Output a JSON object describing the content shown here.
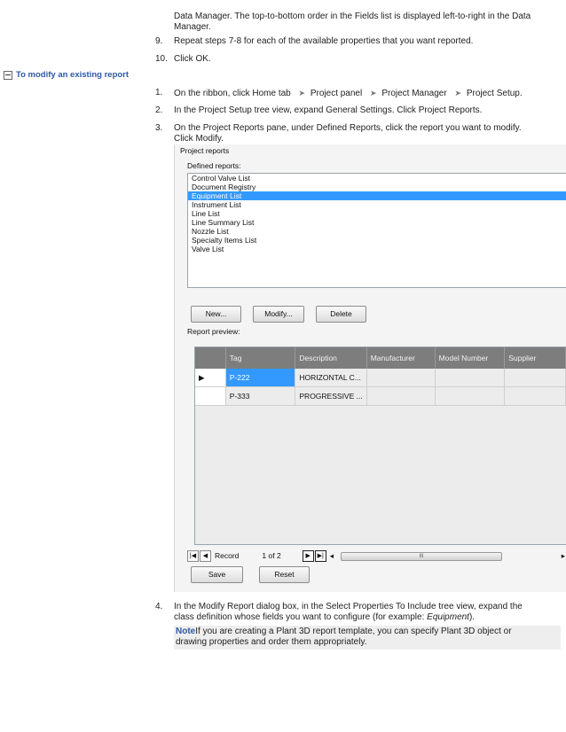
{
  "top_text_lines": [
    "Data Manager.  The top-to-bottom order in the Fields list is displayed left-to-right in the Data",
    "Manager."
  ],
  "steps_before": [
    {
      "num": "9.",
      "text": "Repeat steps 7-8 for each of the available properties that you want reported."
    },
    {
      "num": "10.",
      "text": "Click OK."
    }
  ],
  "section": {
    "label": "To modify an existing report",
    "icon": "collapse-minus-icon"
  },
  "step1": {
    "num": "1.",
    "parts": [
      "On the ribbon, click Home tab",
      "Project panel",
      "Project Manager",
      "Project Setup."
    ],
    "icon": "arrow-right-icon"
  },
  "step2": {
    "num": "2.",
    "text": "In the Project Setup tree view, expand General Settings. Click Project Reports."
  },
  "step3": {
    "num": "3.",
    "lines": [
      "On the Project Reports pane, under Defined Reports, click the report you want to modify.",
      "Click Modify."
    ]
  },
  "panel": {
    "title": "Project reports",
    "defined_label": "Defined reports:",
    "reports": [
      "Control Valve List",
      "Document Registry",
      "Equipment List",
      "Instrument List",
      "Line List",
      "Line Summary List",
      "Nozzle List",
      "Specialty Items List",
      "Valve List"
    ],
    "selected_report": "Equipment List",
    "buttons": {
      "new": "New...",
      "modify": "Modify...",
      "delete": "Delete"
    },
    "preview_label": "Report preview:",
    "grid": {
      "columns": [
        "Tag",
        "Description",
        "Manufacturer",
        "Model Number",
        "Supplier"
      ],
      "rows": [
        {
          "marker": "▶",
          "tag": "P-222",
          "description": "HORIZONTAL C..."
        },
        {
          "marker": "",
          "tag": "P-333",
          "description": "PROGRESSIVE ..."
        }
      ]
    },
    "nav": {
      "record_label": "Record",
      "position": "1 of 2",
      "thumb_glyph": "III",
      "left_arrow": "◂",
      "right_arrow": "▸"
    },
    "save": "Save",
    "reset": "Reset"
  },
  "step4": {
    "num": "4.",
    "lines": [
      "In the Modify Report dialog box, in the Select Properties To Include tree view, expand the",
      "class definition whose fields you want to configure (for example: "
    ],
    "example": "Equipment",
    "end": ")."
  },
  "note": {
    "label": "Note",
    "lines": [
      "If you are creating a Plant 3D report template, you can specify Plant 3D object or",
      "drawing properties and order them appropriately."
    ]
  }
}
